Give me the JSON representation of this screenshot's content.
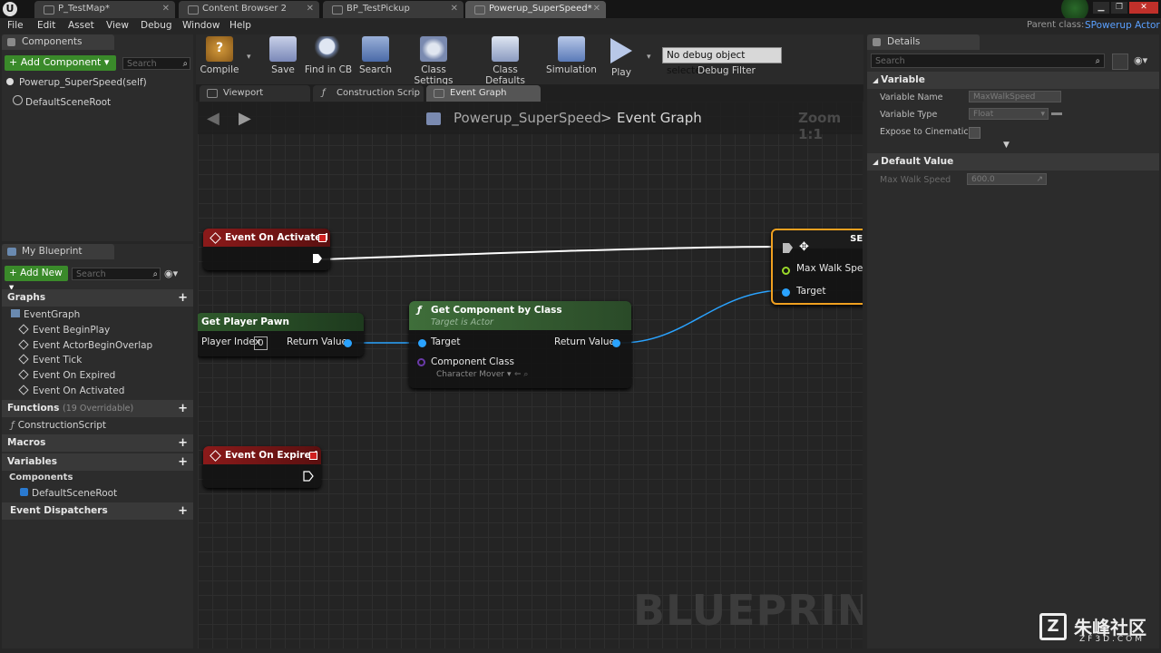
{
  "document_tabs": [
    {
      "label": "P_TestMap*"
    },
    {
      "label": "Content Browser 2"
    },
    {
      "label": "BP_TestPickup"
    },
    {
      "label": "Powerup_SuperSpeed*"
    }
  ],
  "parent_class": {
    "label": "Parent class:",
    "value": "SPowerup Actor"
  },
  "menu": [
    "File",
    "Edit",
    "Asset",
    "View",
    "Debug",
    "Window",
    "Help"
  ],
  "components_panel": {
    "title": "Components",
    "add_button": "+ Add Component ▾",
    "search_placeholder": "Search",
    "self_item": "Powerup_SuperSpeed(self)",
    "root_item": "DefaultSceneRoot"
  },
  "toolbar": {
    "compile": "Compile",
    "save": "Save",
    "find_in_cb": "Find in CB",
    "search": "Search",
    "class_settings": "Class Settings",
    "class_defaults": "Class Defaults",
    "simulation": "Simulation",
    "play": "Play",
    "debug_select": "No debug object selected ▾",
    "debug_filter": "Debug Filter"
  },
  "editor_tabs": [
    {
      "label": "Viewport"
    },
    {
      "label": "Construction Scrip"
    },
    {
      "label": "Event Graph"
    }
  ],
  "graph": {
    "breadcrumb_root": "Powerup_SuperSpeed",
    "breadcrumb_sep": ">",
    "breadcrumb_leaf": "Event Graph",
    "zoom": "Zoom 1:1",
    "watermark": "BLUEPRINT",
    "nodes": {
      "event_on_activated": "Event On Activated",
      "event_on_expired": "Event On Expired",
      "get_player_pawn": {
        "title": "Get Player Pawn",
        "player_index_label": "Player Index",
        "player_index_value": "0",
        "return_value": "Return Value"
      },
      "get_component_by_class": {
        "title": "Get Component by Class",
        "subtitle": "Target is Actor",
        "target": "Target",
        "return_value": "Return Value",
        "component_class": "Component Class",
        "class_value": "Character Mover ▾"
      },
      "set_node": {
        "title": "SET",
        "max_walk_speed": "Max Walk Speed",
        "target": "Target"
      }
    }
  },
  "my_blueprint": {
    "title": "My Blueprint",
    "add_new": "+ Add New ▾",
    "search_placeholder": "Search",
    "graphs_header": "Graphs",
    "event_graph": "EventGraph",
    "events": [
      "Event BeginPlay",
      "Event ActorBeginOverlap",
      "Event Tick",
      "Event On Expired",
      "Event On Activated"
    ],
    "functions_header": "Functions",
    "functions_count": "(19 Overridable)",
    "construction_script": "ConstructionScript",
    "macros_header": "Macros",
    "variables_header": "Variables",
    "components_header": "Components",
    "default_scene_root": "DefaultSceneRoot",
    "event_dispatchers_header": "Event Dispatchers"
  },
  "details": {
    "title": "Details",
    "search_placeholder": "Search",
    "variable_section": "Variable",
    "variable_name_label": "Variable Name",
    "variable_name_value": "MaxWalkSpeed",
    "variable_type_label": "Variable Type",
    "variable_type_value": "Float",
    "expose_label": "Expose to Cinematics",
    "default_section": "Default Value",
    "default_label": "Max Walk Speed",
    "default_value": "600.0"
  },
  "site_watermark": {
    "brand": "朱峰社区",
    "url": "ZF3D.COM"
  },
  "colors": {
    "event_red": "#8b1a1a",
    "function_green": "#2f5a2c",
    "pin_blue": "#2aa3ff",
    "exec_white": "#ffffff",
    "set_orange": "#f0a020"
  }
}
